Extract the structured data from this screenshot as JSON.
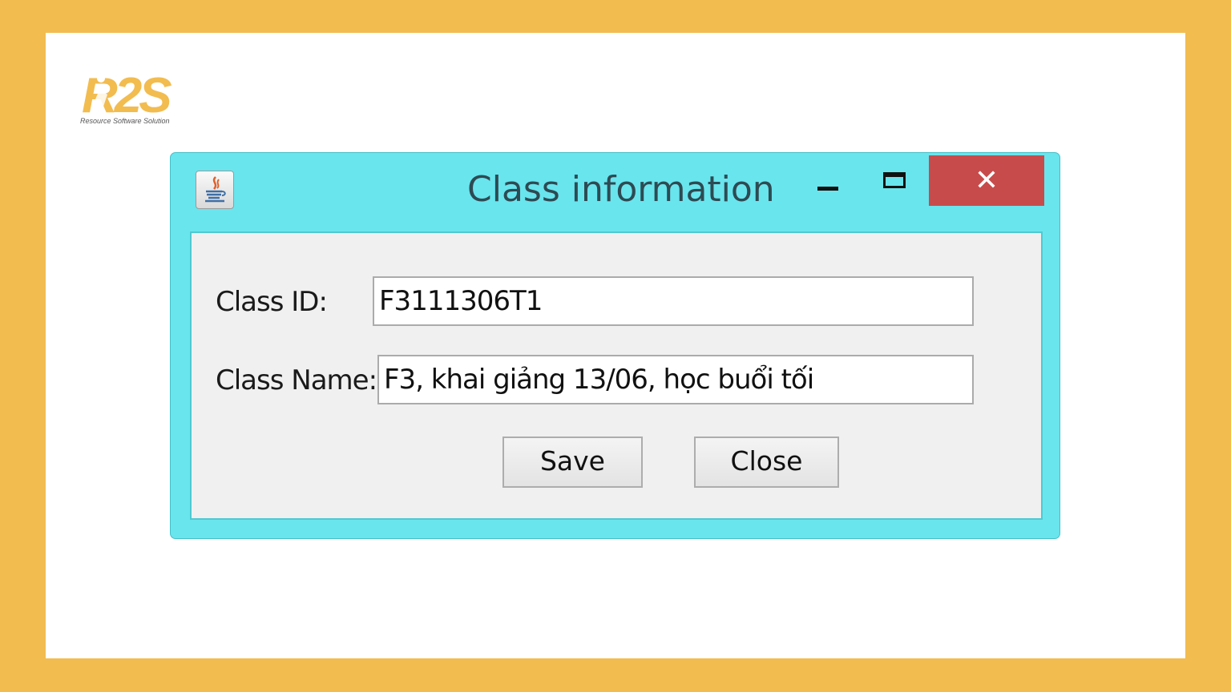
{
  "branding": {
    "logo_text": "R2S",
    "tagline": "Resource Software Solution",
    "colors": {
      "background": "#F2BC4F",
      "logo": "#F2BC4F"
    }
  },
  "window": {
    "title": "Class information",
    "app_icon": "java-icon",
    "controls": {
      "minimize": "minimize-icon",
      "maximize": "maximize-icon",
      "close_symbol": "✕"
    },
    "colors": {
      "frame": "#69E5EE",
      "close": "#C74B4B"
    }
  },
  "form": {
    "class_id_label": "Class ID:",
    "class_id_value": "F3111306T1",
    "class_name_label": "Class Name:",
    "class_name_value": "F3, khai giảng 13/06, học buổi tối",
    "save_label": "Save",
    "close_label": "Close"
  }
}
